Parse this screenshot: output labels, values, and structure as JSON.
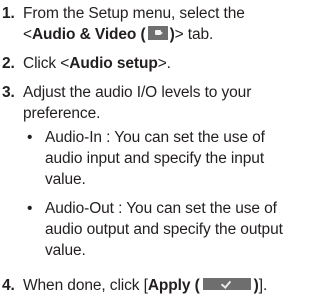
{
  "steps": [
    {
      "num": "1.",
      "line1": "From the Setup menu, select the",
      "pre": "<",
      "bold": "Audio & Video (",
      "bold_close": ")",
      "post": "> tab.",
      "icon": "audio-video-tab-icon"
    },
    {
      "num": "2.",
      "pre": "Click <",
      "bold": "Audio setup",
      "post": ">."
    },
    {
      "num": "3.",
      "line1": "Adjust the audio I/O levels to your",
      "line2": "preference."
    },
    {
      "num": "4.",
      "pre": "When done, click [",
      "bold": "Apply (",
      "bold_close": ")",
      "post": "].",
      "icon": "apply-check-icon"
    }
  ],
  "bullets": [
    {
      "dot": "•",
      "lines": [
        "Audio-In : You can set the use of",
        "audio input and specify the input",
        "value."
      ]
    },
    {
      "dot": "•",
      "lines": [
        "Audio-Out : You can set the use of",
        "audio output and specify the output",
        "value."
      ]
    }
  ],
  "colors": {
    "text": "#231f20",
    "icon_fill": "#6f6f6f"
  }
}
